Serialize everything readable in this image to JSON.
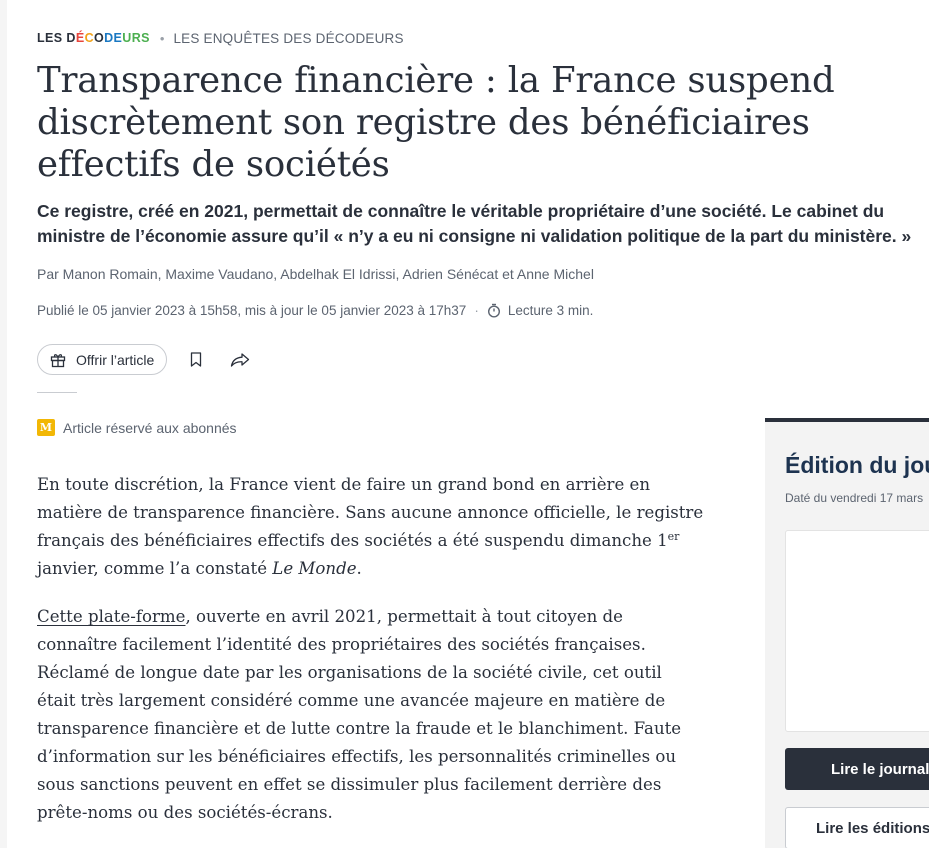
{
  "kicker": {
    "brand_parts": [
      "LES D",
      "É",
      "C",
      "O",
      "DE",
      "URS"
    ],
    "brand": "LES DÉCODEURS",
    "separator": "•",
    "section": "LES ENQUÊTES DES DÉCODEURS"
  },
  "article": {
    "title": "Transparence financière : la France suspend discrètement son registre des bénéficiaires effectifs de sociétés",
    "lede": "Ce registre, créé en 2021, permettait de connaître le véritable propriétaire d’une société. Le cabinet du ministre de l’économie assure qu’il « n’y a eu ni consigne ni validation politique de la part du ministère. »",
    "byline": "Par Manon Romain, Maxime Vaudano, Abdelhak El Idrissi, Adrien Sénécat et Anne Michel",
    "published": "Publié le 05 janvier 2023 à 15h58, mis à jour le 05 janvier 2023 à 17h37",
    "dates_separator": "·",
    "reading_time": "Lecture 3 min.",
    "premium_badge": "M",
    "premium_label": "Article réservé aux abonnés"
  },
  "actions": {
    "gift_label": "Offrir l’article",
    "bookmark_icon": "bookmark-icon",
    "share_icon": "share-icon"
  },
  "body": {
    "p1_a": "En toute discrétion, la France vient de faire un grand bond en arrière en matière de transparence financière. Sans aucune annonce officielle, le registre français des bénéficiaires effectifs des sociétés a été suspendu dimanche 1",
    "p1_sup": "er",
    "p1_b": " janvier, comme l’a constaté ",
    "p1_em": "Le Monde",
    "p1_c": ".",
    "p2_link": "Cette plate-forme",
    "p2_text": ", ouverte en avril 2021, permettait à tout citoyen de connaître facilement l’identité des propriétaires des sociétés françaises. Réclamé de longue date par les organisations de la société civile, cet outil était très largement considéré comme une avancée majeure en matière de transparence financière et de lutte contre la fraude et le blanchiment. Faute d’information sur les bénéficiaires effectifs, les personnalités criminelles ou sous sanctions peuvent en effet se dissimuler plus facilement derrière des prête-noms ou des sociétés-écrans."
  },
  "sidebar": {
    "title": "Édition du jour",
    "date": "Daté du vendredi 17 mars",
    "read_button": "Lire le journal",
    "editions_button": "Lire les éditions"
  },
  "colors": {
    "text": "#2a303b",
    "muted": "#5c6470",
    "premium": "#f2b705",
    "sidebar_title": "#1d3350"
  }
}
